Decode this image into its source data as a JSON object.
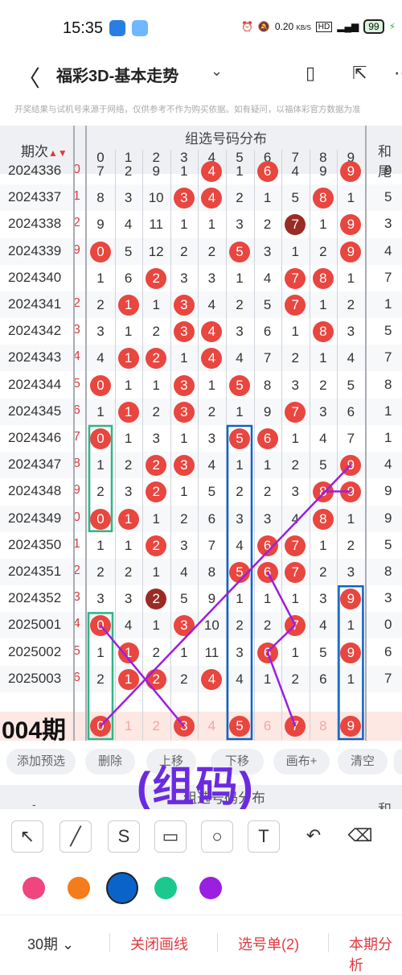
{
  "status": {
    "time": "15:35",
    "speed": "0.20",
    "speed_unit": "KB/S",
    "battery": "99"
  },
  "header": {
    "title": "福彩3D-基本走势",
    "back_icon": "back-arrow-icon",
    "chevron_icon": "chevron-down-icon"
  },
  "disclaimer": "开奖结果与试机号来源于网络，仅供参考不作为购买依据。如有疑问，以福体彩官方数据为准",
  "table": {
    "period_header": "期次",
    "group_header": "组选号码分布",
    "he_header": "和尾",
    "digits": [
      "0",
      "1",
      "2",
      "3",
      "4",
      "5",
      "6",
      "7",
      "8",
      "9"
    ],
    "rows": [
      {
        "period": "2024336",
        "mark": "0",
        "cells": [
          "7",
          "2",
          "9",
          "1",
          "4",
          "1",
          "6",
          "4",
          "9",
          "9"
        ],
        "balls": [
          4,
          6,
          9
        ],
        "dark": [],
        "he": "9"
      },
      {
        "period": "2024337",
        "mark": "1",
        "cells": [
          "8",
          "3",
          "10",
          "3",
          "4",
          "2",
          "1",
          "5",
          "8",
          "1"
        ],
        "balls": [
          3,
          4,
          8
        ],
        "dark": [],
        "he": "5"
      },
      {
        "period": "2024338",
        "mark": "2",
        "cells": [
          "9",
          "4",
          "11",
          "1",
          "1",
          "3",
          "2",
          "7",
          "1",
          "9"
        ],
        "balls": [
          7,
          9
        ],
        "dark": [
          7
        ],
        "he": "3"
      },
      {
        "period": "2024339",
        "mark": "9",
        "cells": [
          "0",
          "5",
          "12",
          "2",
          "2",
          "5",
          "3",
          "1",
          "2",
          "9"
        ],
        "balls": [
          0,
          5,
          9
        ],
        "dark": [],
        "he": "4"
      },
      {
        "period": "2024340",
        "mark": "",
        "cells": [
          "1",
          "6",
          "2",
          "3",
          "3",
          "1",
          "4",
          "7",
          "8",
          "1"
        ],
        "balls": [
          2,
          7,
          8
        ],
        "dark": [],
        "he": "7"
      },
      {
        "period": "2024341",
        "mark": "2",
        "cells": [
          "2",
          "1",
          "1",
          "3",
          "4",
          "2",
          "5",
          "7",
          "1",
          "2"
        ],
        "balls": [
          1,
          3,
          7
        ],
        "dark": [],
        "he": "1"
      },
      {
        "period": "2024342",
        "mark": "3",
        "cells": [
          "3",
          "1",
          "2",
          "3",
          "4",
          "3",
          "6",
          "1",
          "8",
          "3"
        ],
        "balls": [
          3,
          4,
          8
        ],
        "dark": [],
        "he": "5"
      },
      {
        "period": "2024343",
        "mark": "4",
        "cells": [
          "4",
          "1",
          "2",
          "1",
          "4",
          "4",
          "7",
          "2",
          "1",
          "4"
        ],
        "balls": [
          1,
          2,
          4
        ],
        "dark": [],
        "he": "7"
      },
      {
        "period": "2024344",
        "mark": "5",
        "cells": [
          "0",
          "1",
          "1",
          "3",
          "1",
          "5",
          "8",
          "3",
          "2",
          "5"
        ],
        "balls": [
          0,
          3,
          5
        ],
        "dark": [],
        "he": "8"
      },
      {
        "period": "2024345",
        "mark": "6",
        "cells": [
          "1",
          "1",
          "2",
          "3",
          "2",
          "1",
          "9",
          "7",
          "3",
          "6"
        ],
        "balls": [
          1,
          3,
          7
        ],
        "dark": [],
        "he": "1"
      },
      {
        "period": "2024346",
        "mark": "7",
        "cells": [
          "0",
          "1",
          "3",
          "1",
          "3",
          "5",
          "6",
          "1",
          "4",
          "7"
        ],
        "balls": [
          0,
          5,
          6
        ],
        "dark": [],
        "he": "1"
      },
      {
        "period": "2024347",
        "mark": "8",
        "cells": [
          "1",
          "2",
          "2",
          "3",
          "4",
          "1",
          "1",
          "2",
          "5",
          "9"
        ],
        "balls": [
          2,
          3,
          9
        ],
        "dark": [],
        "he": "4"
      },
      {
        "period": "2024348",
        "mark": "9",
        "cells": [
          "2",
          "3",
          "2",
          "1",
          "5",
          "2",
          "2",
          "3",
          "8",
          "9"
        ],
        "balls": [
          2,
          8,
          9
        ],
        "dark": [],
        "he": "9"
      },
      {
        "period": "2024349",
        "mark": "0",
        "cells": [
          "0",
          "1",
          "1",
          "2",
          "6",
          "3",
          "3",
          "4",
          "8",
          "1"
        ],
        "balls": [
          0,
          1,
          8
        ],
        "dark": [],
        "he": "9"
      },
      {
        "period": "2024350",
        "mark": "1",
        "cells": [
          "1",
          "1",
          "2",
          "3",
          "7",
          "4",
          "6",
          "7",
          "1",
          "2"
        ],
        "balls": [
          2,
          6,
          7
        ],
        "dark": [],
        "he": "5"
      },
      {
        "period": "2024351",
        "mark": "2",
        "cells": [
          "2",
          "2",
          "1",
          "4",
          "8",
          "5",
          "6",
          "7",
          "2",
          "3"
        ],
        "balls": [
          5,
          6,
          7
        ],
        "dark": [],
        "he": "8"
      },
      {
        "period": "2024352",
        "mark": "3",
        "cells": [
          "3",
          "3",
          "2",
          "5",
          "9",
          "1",
          "1",
          "1",
          "3",
          "9"
        ],
        "balls": [
          2,
          9
        ],
        "dark": [
          2
        ],
        "he": "3"
      },
      {
        "period": "2025001",
        "mark": "4",
        "cells": [
          "0",
          "4",
          "1",
          "3",
          "10",
          "2",
          "2",
          "7",
          "4",
          "1"
        ],
        "balls": [
          0,
          3,
          7
        ],
        "dark": [],
        "he": "0"
      },
      {
        "period": "2025002",
        "mark": "5",
        "cells": [
          "1",
          "1",
          "2",
          "1",
          "11",
          "3",
          "6",
          "1",
          "5",
          "9"
        ],
        "balls": [
          1,
          6,
          9
        ],
        "dark": [],
        "he": "6"
      },
      {
        "period": "2025003",
        "mark": "6",
        "cells": [
          "2",
          "1",
          "2",
          "2",
          "4",
          "4",
          "1",
          "2",
          "6",
          "1"
        ],
        "balls": [
          1,
          2,
          4
        ],
        "dark": [],
        "he": "7"
      }
    ],
    "prediction": {
      "label": "004期",
      "cells": [
        "0",
        "1",
        "2",
        "3",
        "4",
        "5",
        "6",
        "7",
        "8",
        "9"
      ],
      "balls": [
        0,
        3,
        5,
        7,
        9
      ]
    }
  },
  "toolbar": [
    "添加预选",
    "删除",
    "上移",
    "下移",
    "画布+",
    "清空"
  ],
  "annotation_text": "(组码)",
  "draw_tools": [
    "arrow-tool-icon",
    "line-tool-icon",
    "freehand-tool-icon",
    "rectangle-tool-icon",
    "circle-tool-icon",
    "text-tool-icon",
    "undo-icon",
    "eraser-icon"
  ],
  "text_tool_glyph": "T",
  "colors": {
    "pink": "#f0457f",
    "orange": "#f57c1a",
    "blue": "#0a63c9",
    "green": "#1bc98e",
    "purple": "#9b1fe0",
    "ball": "#e8463f",
    "ball_dark": "#9b2b25",
    "accent": "#e0393e"
  },
  "bottom": {
    "periods": "30期",
    "close": "关闭画线",
    "picklist": "选号单(2)",
    "analysis": "本期分析"
  }
}
